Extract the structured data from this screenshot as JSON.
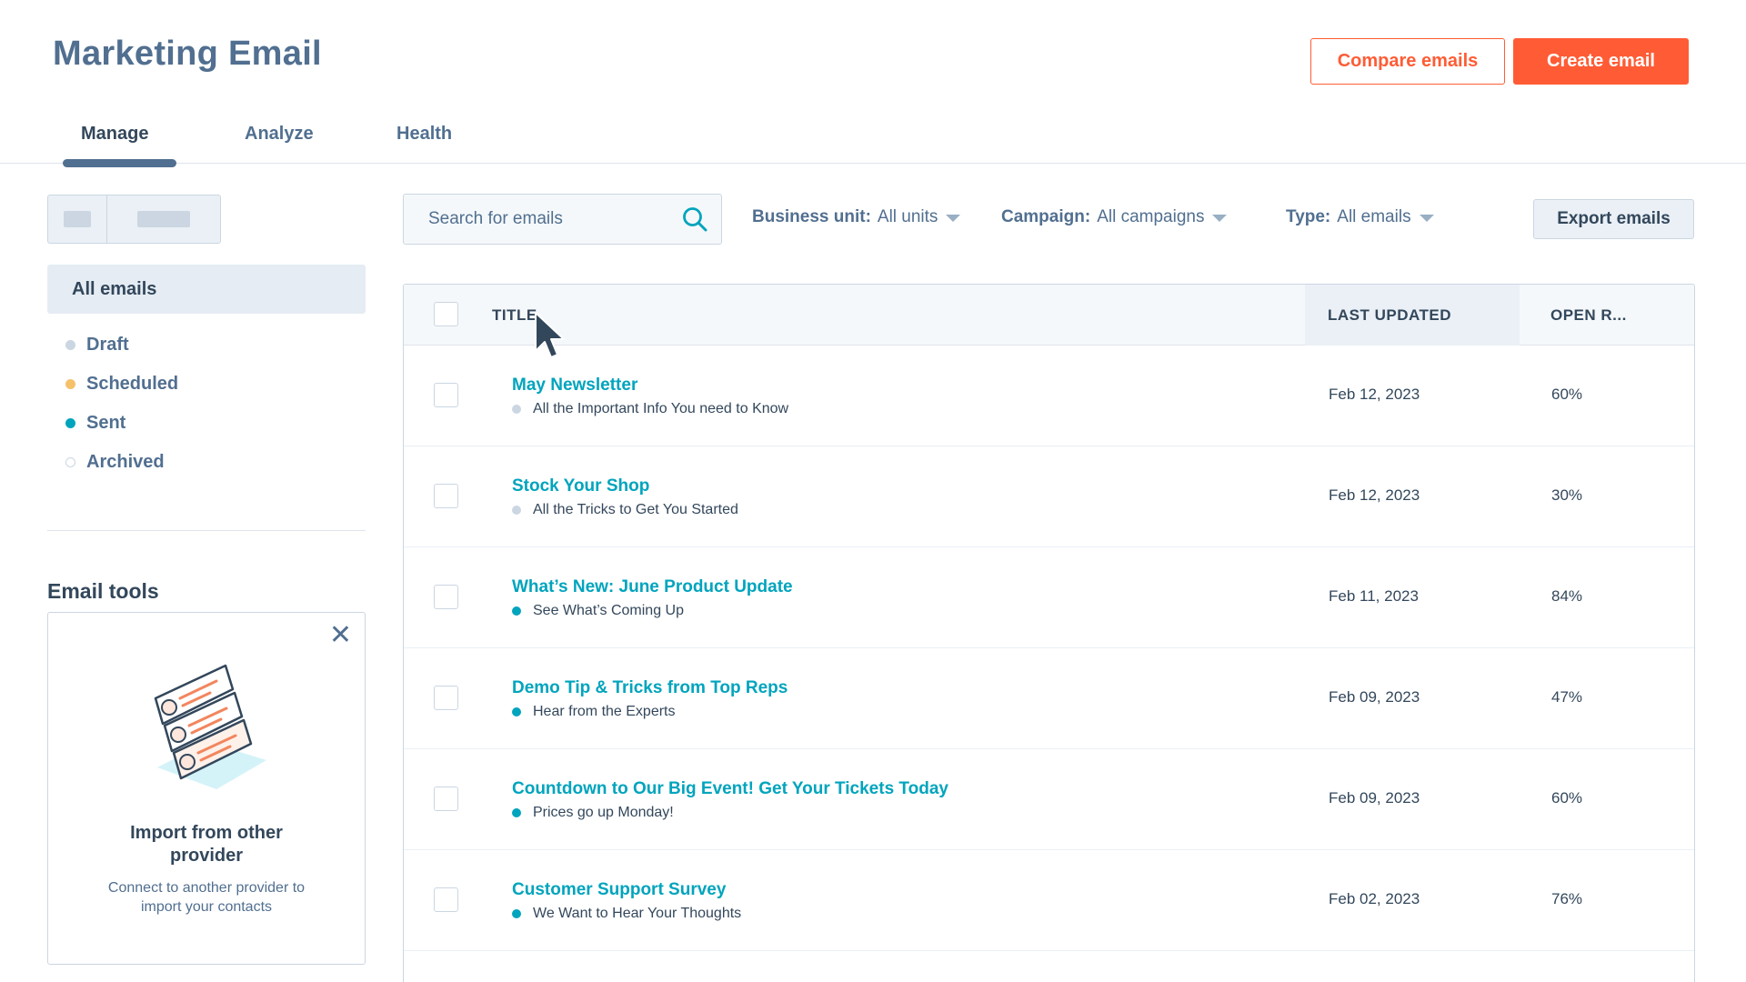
{
  "header": {
    "title": "Marketing Email",
    "compare_label": "Compare emails",
    "create_label": "Create email"
  },
  "tabs": [
    {
      "label": "Manage",
      "active": true
    },
    {
      "label": "Analyze",
      "active": false
    },
    {
      "label": "Health",
      "active": false
    }
  ],
  "sidebar": {
    "all_label": "All emails",
    "statuses": [
      {
        "label": "Draft",
        "color": "#cbd6e2"
      },
      {
        "label": "Scheduled",
        "color": "#f5c26b"
      },
      {
        "label": "Sent",
        "color": "#00a4bd"
      },
      {
        "label": "Archived",
        "color": "#ffffff"
      }
    ],
    "tools_heading": "Email tools",
    "tool_card": {
      "title": "Import from other provider",
      "description": "Connect to another provider to import your contacts",
      "icon": "import-provider-illustration"
    }
  },
  "toolbar": {
    "search_placeholder": "Search for emails",
    "filters": [
      {
        "label": "Business unit:",
        "value": "All units"
      },
      {
        "label": "Campaign:",
        "value": "All campaigns"
      },
      {
        "label": "Type:",
        "value": "All emails"
      }
    ],
    "export_label": "Export emails"
  },
  "table": {
    "columns": [
      "TITLE",
      "LAST UPDATED",
      "OPEN R..."
    ],
    "rows": [
      {
        "title": "May Newsletter",
        "subtitle": "All the Important Info You need to Know",
        "status": "draft",
        "last_updated": "Feb 12, 2023",
        "open_rate": "60%"
      },
      {
        "title": "Stock Your Shop",
        "subtitle": "All the Tricks to Get You Started",
        "status": "draft",
        "last_updated": "Feb 12, 2023",
        "open_rate": "30%"
      },
      {
        "title": "What’s New: June Product Update",
        "subtitle": "See What’s Coming Up",
        "status": "sent",
        "last_updated": "Feb 11, 2023",
        "open_rate": "84%"
      },
      {
        "title": "Demo Tip & Tricks from Top Reps",
        "subtitle": "Hear from the Experts",
        "status": "sent",
        "last_updated": "Feb 09, 2023",
        "open_rate": "47%"
      },
      {
        "title": "Countdown to Our Big Event! Get Your Tickets Today",
        "subtitle": "Prices go up Monday!",
        "status": "sent",
        "last_updated": "Feb 09, 2023",
        "open_rate": "60%"
      },
      {
        "title": "Customer Support Survey",
        "subtitle": "We Want to Hear Your Thoughts",
        "status": "sent",
        "last_updated": "Feb 02, 2023",
        "open_rate": "76%"
      }
    ]
  },
  "colors": {
    "accent": "#ff5c35",
    "link": "#00a4bd",
    "text_primary": "#33475b",
    "text_secondary": "#516f90"
  }
}
